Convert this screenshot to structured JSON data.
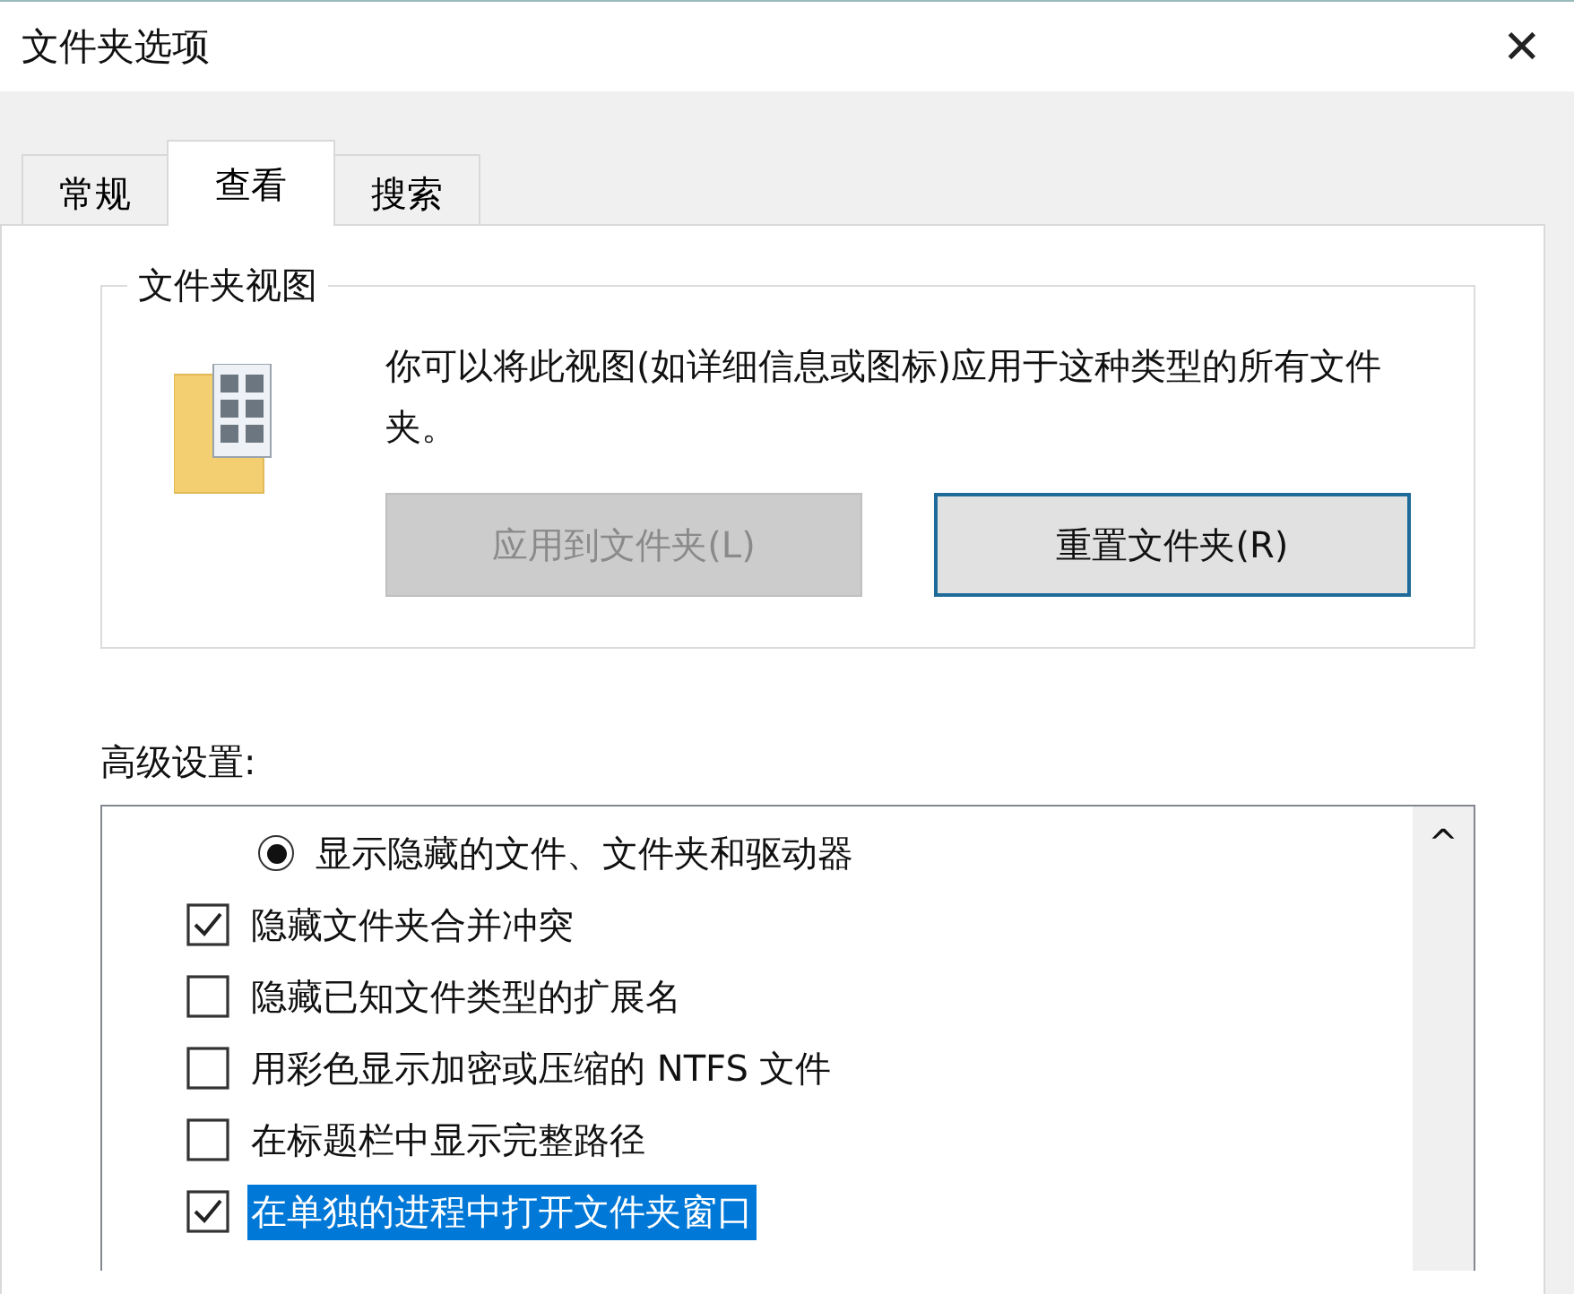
{
  "window": {
    "title": "文件夹选项",
    "close": "✕"
  },
  "tabs": [
    {
      "label": "常规",
      "selected": false
    },
    {
      "label": "查看",
      "selected": true
    },
    {
      "label": "搜索",
      "selected": false
    }
  ],
  "folder_views": {
    "title": "文件夹视图",
    "description": "你可以将此视图(如详细信息或图标)应用于这种类型的所有文件夹。",
    "buttons": [
      {
        "label": "应用到文件夹(L)",
        "disabled": true,
        "focused": false
      },
      {
        "label": "重置文件夹(R)",
        "disabled": false,
        "focused": true
      }
    ]
  },
  "advanced": {
    "label": "高级设置:",
    "scroll_up": "^",
    "items": [
      {
        "kind": "radio",
        "label": "显示隐藏的文件、文件夹和驱动器",
        "checked": true,
        "selected": false
      },
      {
        "kind": "checkbox",
        "label": "隐藏文件夹合并冲突",
        "checked": true,
        "selected": false
      },
      {
        "kind": "checkbox",
        "label": "隐藏已知文件类型的扩展名",
        "checked": false,
        "selected": false
      },
      {
        "kind": "checkbox",
        "label": "用彩色显示加密或压缩的 NTFS 文件",
        "checked": false,
        "selected": false
      },
      {
        "kind": "checkbox",
        "label": "在标题栏中显示完整路径",
        "checked": false,
        "selected": false
      },
      {
        "kind": "checkbox",
        "label": "在单独的进程中打开文件夹窗口",
        "checked": true,
        "selected": true
      }
    ]
  }
}
